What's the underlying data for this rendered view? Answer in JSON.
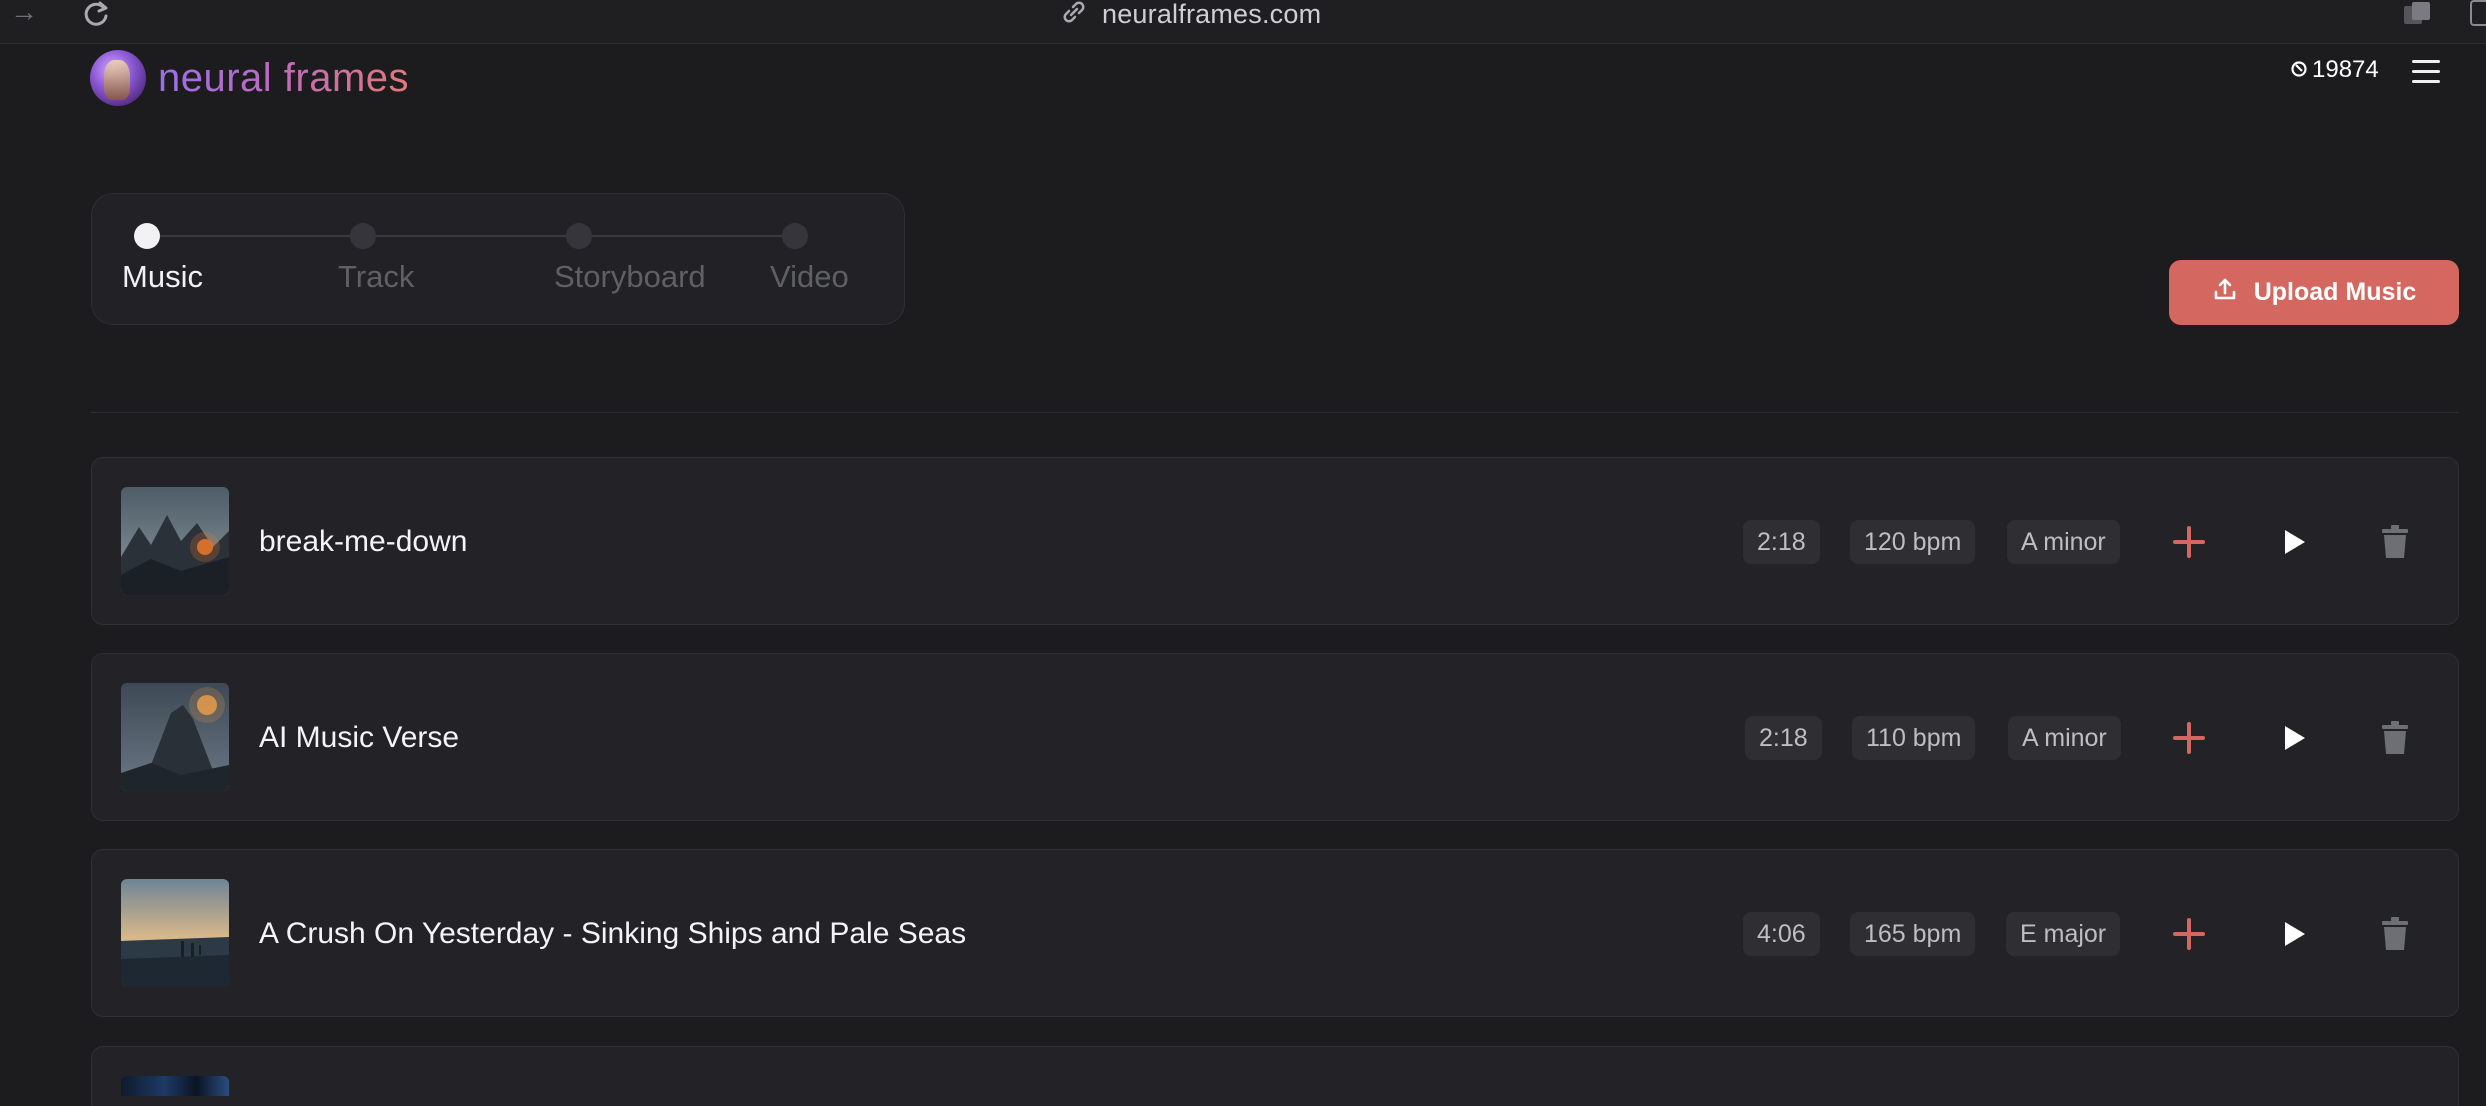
{
  "browser": {
    "url": "neuralframes.com"
  },
  "header": {
    "brand": "neural frames",
    "credits": "19874"
  },
  "stepper": {
    "steps": [
      {
        "label": "Music",
        "active": true
      },
      {
        "label": "Track",
        "active": false
      },
      {
        "label": "Storyboard",
        "active": false
      },
      {
        "label": "Video",
        "active": false
      }
    ]
  },
  "upload": {
    "label": "Upload Music"
  },
  "tracks": [
    {
      "title": "break-me-down",
      "duration": "2:18",
      "bpm": "120 bpm",
      "key": "A minor"
    },
    {
      "title": "AI Music Verse",
      "duration": "2:18",
      "bpm": "110 bpm",
      "key": "A minor"
    },
    {
      "title": "A Crush On Yesterday - Sinking Ships and Pale Seas",
      "duration": "4:06",
      "bpm": "165 bpm",
      "key": "E major"
    }
  ],
  "colors": {
    "accent": "#d4675f",
    "background": "#1c1c1f",
    "card": "#232327"
  },
  "icons": {
    "add": "plus-icon",
    "play": "play-icon",
    "delete": "trash-icon",
    "upload": "upload-icon",
    "menu": "hamburger-menu-icon"
  }
}
